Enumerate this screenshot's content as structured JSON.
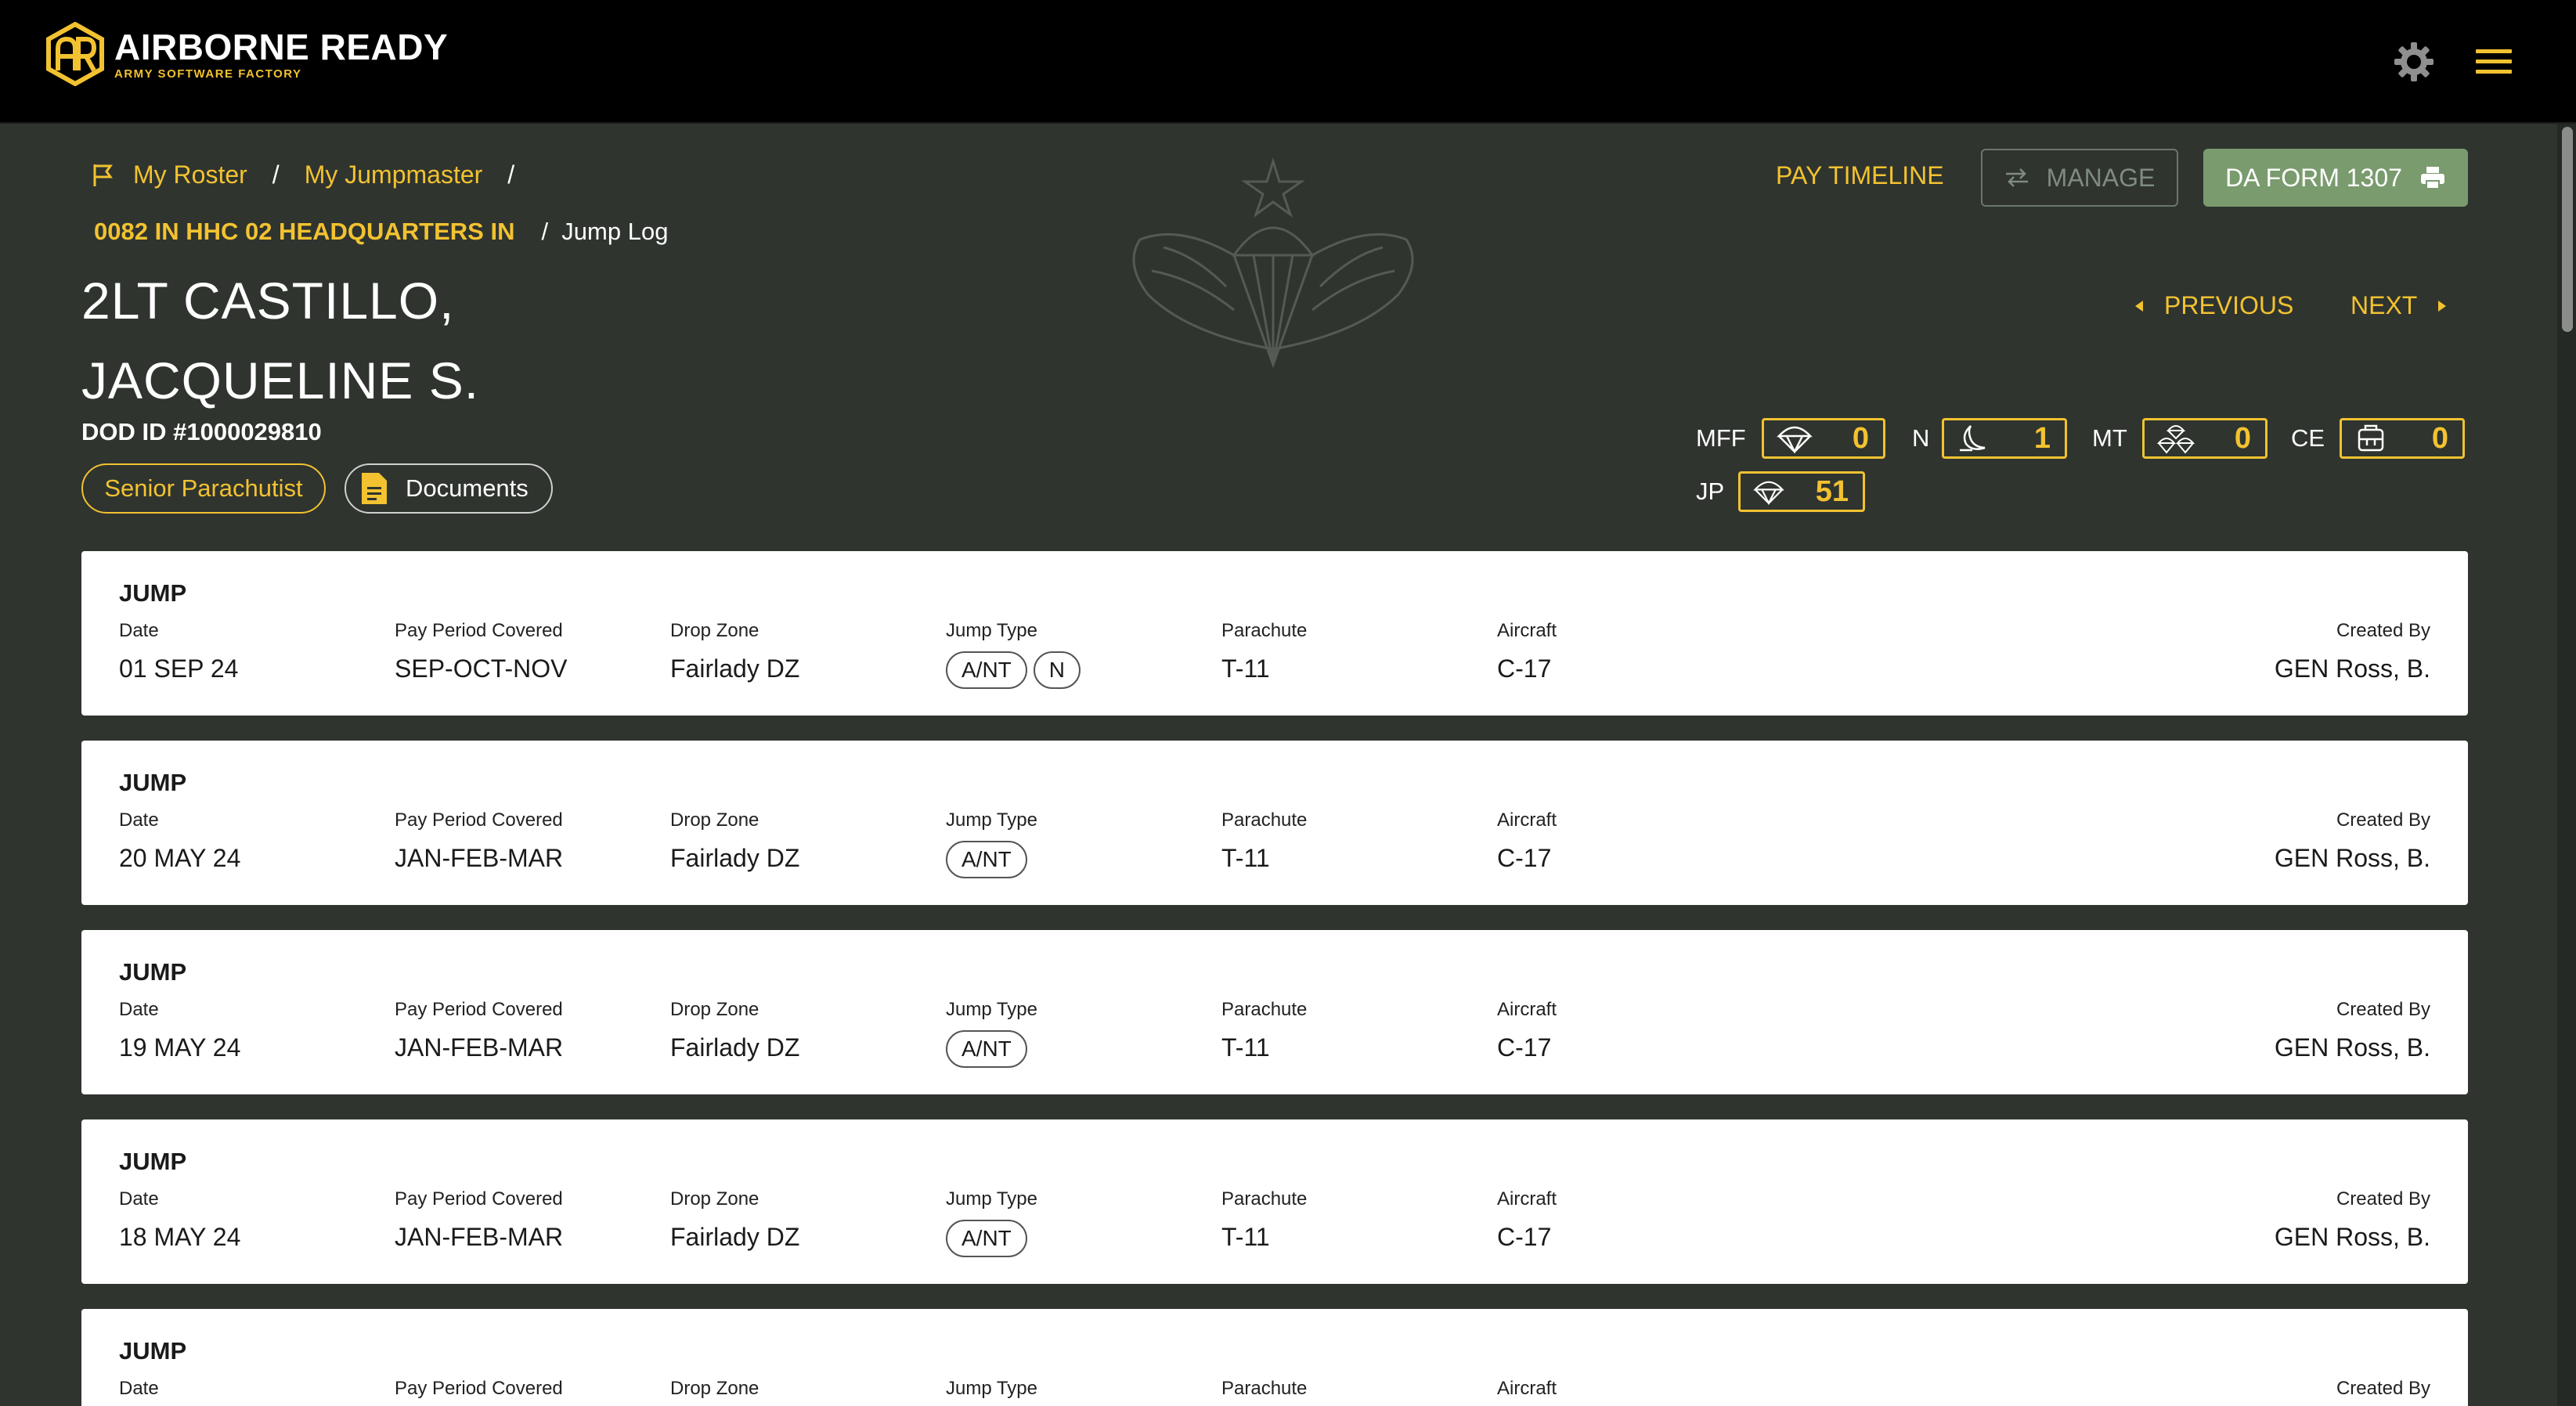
{
  "app": {
    "title": "AIRBORNE READY",
    "subtitle": "ARMY SOFTWARE FACTORY",
    "icons": [
      "gear-icon",
      "hamburger-menu-icon"
    ]
  },
  "breadcrumb": {
    "roster": "My Roster",
    "jumpmaster": "My Jumpmaster",
    "sep": "/",
    "unit": "0082 IN HHC 02 HEADQUARTERS IN",
    "current": "/  Jump Log"
  },
  "soldier": {
    "name_line1": "2LT CASTILLO,",
    "name_line2": "JACQUELINE S.",
    "dod_id": "DOD ID #1000029810",
    "badge": "Senior Parachutist",
    "documents_label": "Documents"
  },
  "actions": {
    "pay_timeline": "PAY TIMELINE",
    "manage": "MANAGE",
    "da_form": "DA FORM 1307",
    "previous": "PREVIOUS",
    "next": "NEXT"
  },
  "counters": {
    "mff": {
      "label": "MFF",
      "value": "0",
      "icon": "parachute-icon"
    },
    "n": {
      "label": "N",
      "value": "1",
      "icon": "moon-icon"
    },
    "mt": {
      "label": "MT",
      "value": "0",
      "icon": "mass-tactical-icon"
    },
    "ce": {
      "label": "CE",
      "value": "0",
      "icon": "combat-equipment-icon"
    },
    "jp": {
      "label": "JP",
      "value": "51",
      "icon": "parachute-icon"
    }
  },
  "jump_columns": {
    "title": "JUMP",
    "date": "Date",
    "pay_period": "Pay Period Covered",
    "drop_zone": "Drop Zone",
    "jump_type": "Jump Type",
    "parachute": "Parachute",
    "aircraft": "Aircraft",
    "created_by": "Created By"
  },
  "jumps": [
    {
      "date": "01 SEP 24",
      "pay_period": "SEP-OCT-NOV",
      "drop_zone": "Fairlady DZ",
      "types": [
        "A/NT",
        "N"
      ],
      "parachute": "T-11",
      "aircraft": "C-17",
      "created_by": "GEN Ross, B."
    },
    {
      "date": "20 MAY 24",
      "pay_period": "JAN-FEB-MAR",
      "drop_zone": "Fairlady DZ",
      "types": [
        "A/NT"
      ],
      "parachute": "T-11",
      "aircraft": "C-17",
      "created_by": "GEN Ross, B."
    },
    {
      "date": "19 MAY 24",
      "pay_period": "JAN-FEB-MAR",
      "drop_zone": "Fairlady DZ",
      "types": [
        "A/NT"
      ],
      "parachute": "T-11",
      "aircraft": "C-17",
      "created_by": "GEN Ross, B."
    },
    {
      "date": "18 MAY 24",
      "pay_period": "JAN-FEB-MAR",
      "drop_zone": "Fairlady DZ",
      "types": [
        "A/NT"
      ],
      "parachute": "T-11",
      "aircraft": "C-17",
      "created_by": "GEN Ross, B."
    }
  ],
  "colors": {
    "accent": "#f2c230",
    "background": "#2f342f",
    "topbar": "#000000",
    "primary_button": "#7a9b6e"
  }
}
